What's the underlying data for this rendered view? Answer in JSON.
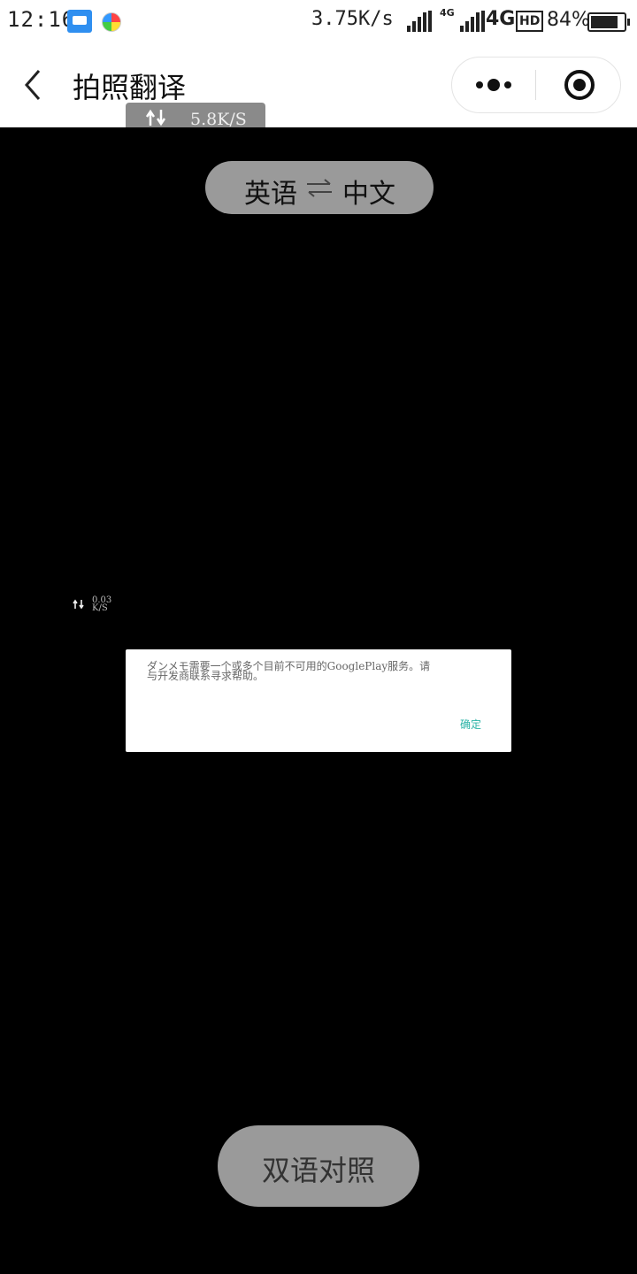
{
  "status_bar": {
    "time": "12:16",
    "net_speed": "3.75K/s",
    "net_type_small": "4G",
    "net_type": "4G",
    "hd": "HD",
    "battery_percent": "84%",
    "battery_level": 0.84
  },
  "nav": {
    "title": "拍照翻译"
  },
  "overlay_speed": "5.8K/S",
  "language": {
    "source": "英语",
    "target": "中文"
  },
  "tiny_speed": "0.03\nK/S",
  "dialog": {
    "message": "ダンメモ需要一个或多个目前不可用的GooglePlay服务。请与开发商联系寻求帮助。",
    "ok_label": "确定"
  },
  "bottom_button": {
    "label": "双语对照"
  },
  "colors": {
    "camera_background": "#000000",
    "pill_gray": "#9a9a9a",
    "dialog_accent": "#2ab3a6",
    "notification_blue": "#2f8ff0"
  },
  "icons": [
    "message-icon",
    "color-wheel-icon",
    "signal-icon",
    "battery-icon",
    "back-icon",
    "more-icon",
    "close-icon",
    "swap-icon",
    "sync-icon"
  ]
}
